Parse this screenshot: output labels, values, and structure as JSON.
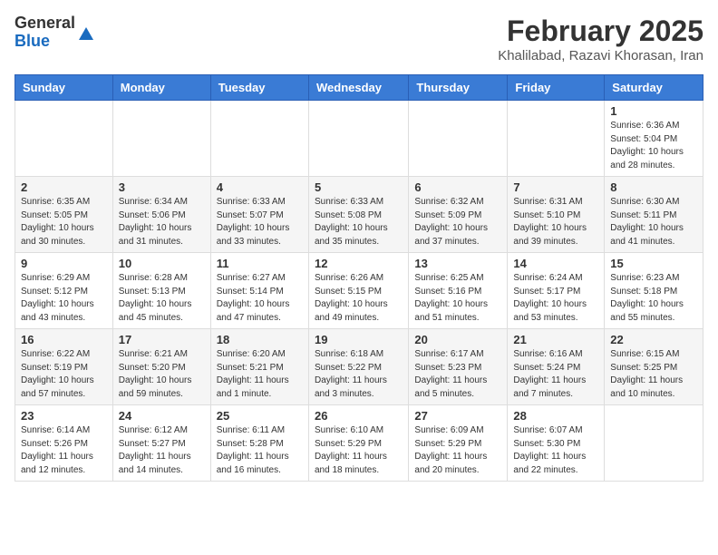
{
  "logo": {
    "general": "General",
    "blue": "Blue"
  },
  "header": {
    "month": "February 2025",
    "location": "Khalilabad, Razavi Khorasan, Iran"
  },
  "days_of_week": [
    "Sunday",
    "Monday",
    "Tuesday",
    "Wednesday",
    "Thursday",
    "Friday",
    "Saturday"
  ],
  "weeks": [
    [
      {
        "day": "",
        "info": ""
      },
      {
        "day": "",
        "info": ""
      },
      {
        "day": "",
        "info": ""
      },
      {
        "day": "",
        "info": ""
      },
      {
        "day": "",
        "info": ""
      },
      {
        "day": "",
        "info": ""
      },
      {
        "day": "1",
        "info": "Sunrise: 6:36 AM\nSunset: 5:04 PM\nDaylight: 10 hours and 28 minutes."
      }
    ],
    [
      {
        "day": "2",
        "info": "Sunrise: 6:35 AM\nSunset: 5:05 PM\nDaylight: 10 hours and 30 minutes."
      },
      {
        "day": "3",
        "info": "Sunrise: 6:34 AM\nSunset: 5:06 PM\nDaylight: 10 hours and 31 minutes."
      },
      {
        "day": "4",
        "info": "Sunrise: 6:33 AM\nSunset: 5:07 PM\nDaylight: 10 hours and 33 minutes."
      },
      {
        "day": "5",
        "info": "Sunrise: 6:33 AM\nSunset: 5:08 PM\nDaylight: 10 hours and 35 minutes."
      },
      {
        "day": "6",
        "info": "Sunrise: 6:32 AM\nSunset: 5:09 PM\nDaylight: 10 hours and 37 minutes."
      },
      {
        "day": "7",
        "info": "Sunrise: 6:31 AM\nSunset: 5:10 PM\nDaylight: 10 hours and 39 minutes."
      },
      {
        "day": "8",
        "info": "Sunrise: 6:30 AM\nSunset: 5:11 PM\nDaylight: 10 hours and 41 minutes."
      }
    ],
    [
      {
        "day": "9",
        "info": "Sunrise: 6:29 AM\nSunset: 5:12 PM\nDaylight: 10 hours and 43 minutes."
      },
      {
        "day": "10",
        "info": "Sunrise: 6:28 AM\nSunset: 5:13 PM\nDaylight: 10 hours and 45 minutes."
      },
      {
        "day": "11",
        "info": "Sunrise: 6:27 AM\nSunset: 5:14 PM\nDaylight: 10 hours and 47 minutes."
      },
      {
        "day": "12",
        "info": "Sunrise: 6:26 AM\nSunset: 5:15 PM\nDaylight: 10 hours and 49 minutes."
      },
      {
        "day": "13",
        "info": "Sunrise: 6:25 AM\nSunset: 5:16 PM\nDaylight: 10 hours and 51 minutes."
      },
      {
        "day": "14",
        "info": "Sunrise: 6:24 AM\nSunset: 5:17 PM\nDaylight: 10 hours and 53 minutes."
      },
      {
        "day": "15",
        "info": "Sunrise: 6:23 AM\nSunset: 5:18 PM\nDaylight: 10 hours and 55 minutes."
      }
    ],
    [
      {
        "day": "16",
        "info": "Sunrise: 6:22 AM\nSunset: 5:19 PM\nDaylight: 10 hours and 57 minutes."
      },
      {
        "day": "17",
        "info": "Sunrise: 6:21 AM\nSunset: 5:20 PM\nDaylight: 10 hours and 59 minutes."
      },
      {
        "day": "18",
        "info": "Sunrise: 6:20 AM\nSunset: 5:21 PM\nDaylight: 11 hours and 1 minute."
      },
      {
        "day": "19",
        "info": "Sunrise: 6:18 AM\nSunset: 5:22 PM\nDaylight: 11 hours and 3 minutes."
      },
      {
        "day": "20",
        "info": "Sunrise: 6:17 AM\nSunset: 5:23 PM\nDaylight: 11 hours and 5 minutes."
      },
      {
        "day": "21",
        "info": "Sunrise: 6:16 AM\nSunset: 5:24 PM\nDaylight: 11 hours and 7 minutes."
      },
      {
        "day": "22",
        "info": "Sunrise: 6:15 AM\nSunset: 5:25 PM\nDaylight: 11 hours and 10 minutes."
      }
    ],
    [
      {
        "day": "23",
        "info": "Sunrise: 6:14 AM\nSunset: 5:26 PM\nDaylight: 11 hours and 12 minutes."
      },
      {
        "day": "24",
        "info": "Sunrise: 6:12 AM\nSunset: 5:27 PM\nDaylight: 11 hours and 14 minutes."
      },
      {
        "day": "25",
        "info": "Sunrise: 6:11 AM\nSunset: 5:28 PM\nDaylight: 11 hours and 16 minutes."
      },
      {
        "day": "26",
        "info": "Sunrise: 6:10 AM\nSunset: 5:29 PM\nDaylight: 11 hours and 18 minutes."
      },
      {
        "day": "27",
        "info": "Sunrise: 6:09 AM\nSunset: 5:29 PM\nDaylight: 11 hours and 20 minutes."
      },
      {
        "day": "28",
        "info": "Sunrise: 6:07 AM\nSunset: 5:30 PM\nDaylight: 11 hours and 22 minutes."
      },
      {
        "day": "",
        "info": ""
      }
    ]
  ]
}
